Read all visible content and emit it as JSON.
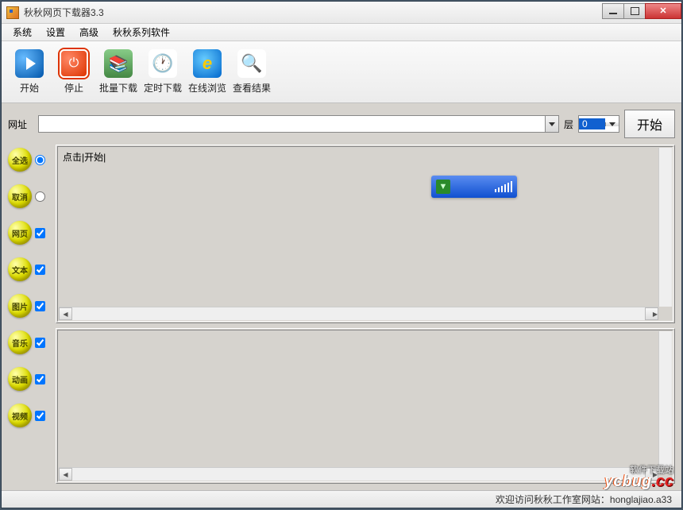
{
  "window": {
    "title": "秋秋网页下载器3.3"
  },
  "menu": {
    "items": [
      "系统",
      "设置",
      "高级",
      "秋秋系列软件"
    ]
  },
  "toolbar": {
    "start": "开始",
    "stop": "停止",
    "batch": "批量下载",
    "timer": "定时下载",
    "browse": "在线浏览",
    "results": "查看结果"
  },
  "url_row": {
    "label": "网址",
    "value": "",
    "layer_label": "层",
    "layer_value": "0",
    "start_button": "开始"
  },
  "sidebar": {
    "items": [
      {
        "label": "全选",
        "type": "radio",
        "checked": true
      },
      {
        "label": "取消",
        "type": "radio",
        "checked": false
      },
      {
        "label": "网页",
        "type": "checkbox",
        "checked": true
      },
      {
        "label": "文本",
        "type": "checkbox",
        "checked": true
      },
      {
        "label": "图片",
        "type": "checkbox",
        "checked": true
      },
      {
        "label": "音乐",
        "type": "checkbox",
        "checked": true
      },
      {
        "label": "动画",
        "type": "checkbox",
        "checked": true
      },
      {
        "label": "视频",
        "type": "checkbox",
        "checked": true
      }
    ]
  },
  "pane1": {
    "hint": "点击|开始|"
  },
  "statusbar": {
    "text": "欢迎访问秋秋工作室网站：honglajiao.a33"
  },
  "watermark": {
    "sub": "软件下载站",
    "main": "ycbug",
    "suffix": ".cc"
  }
}
